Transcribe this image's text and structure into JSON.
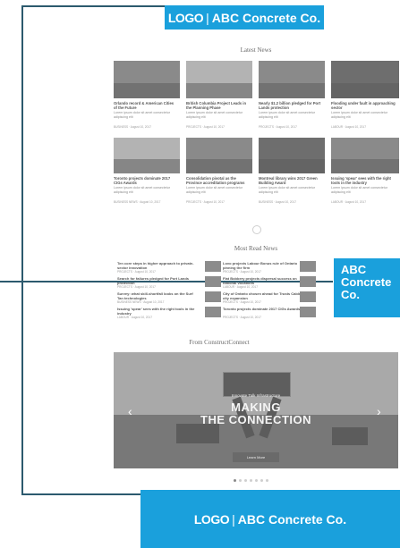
{
  "banners": {
    "top": {
      "logo": "LOGO",
      "separator": "|",
      "company": "ABC Concrete Co."
    },
    "side": {
      "lines": [
        "ABC",
        "Concrete",
        "Co."
      ]
    },
    "bottom": {
      "logo": "LOGO",
      "separator": "|",
      "company": "ABC Concrete Co."
    }
  },
  "page": {
    "latest_heading": "Latest News",
    "latest_cards": [
      {
        "title": "Orlando record & American Cities of the Future",
        "text": "Lorem ipsum dolor sit amet consectetur adipiscing elit",
        "meta": "BUSINESS · August 10, 2017"
      },
      {
        "title": "British Columbia Project Leads in the Planning Phase",
        "text": "Lorem ipsum dolor sit amet consectetur adipiscing elit",
        "meta": "PROJECTS · August 10, 2017"
      },
      {
        "title": "Nearly $1.2 billion pledged for Port Lands protection",
        "text": "Lorem ipsum dolor sit amet consectetur adipiscing elit",
        "meta": "PROJECTS · August 10, 2017"
      },
      {
        "title": "Flooding under fault in approaching sector",
        "text": "Lorem ipsum dolor sit amet consectetur adipiscing elit",
        "meta": "LABOUR · August 10, 2017"
      },
      {
        "title": "Toronto projects dominate 2017 CIGs Awards",
        "text": "Lorem ipsum dolor sit amet consectetur adipiscing elit",
        "meta": "BUSINESS NEWS · August 10, 2017"
      },
      {
        "title": "Consolidation pivotal as the Province accreditation programs",
        "text": "Lorem ipsum dolor sit amet consectetur adipiscing elit",
        "meta": "PROJECTS · August 10, 2017"
      },
      {
        "title": "Montreal library wins 2017 Green Building Award",
        "text": "Lorem ipsum dolor sit amet consectetur adipiscing elit",
        "meta": "BUSINESS · August 10, 2017"
      },
      {
        "title": "Issuing 'spear' sees with the right tools in the industry",
        "text": "Lorem ipsum dolor sit amet consectetur adipiscing elit",
        "meta": "LABOUR · August 10, 2017"
      }
    ],
    "most_read_heading": "Most Read News",
    "most_read": [
      {
        "title": "Ten core steps in higher approach to private-sector innovation",
        "meta": "PROJECTS · August 10, 2017"
      },
      {
        "title": "Search for failures pledged for Port Lands protection",
        "meta": "PROJECTS · August 10, 2017"
      },
      {
        "title": "Survey: what skill-shortfall looks on the Surf Tan technologies",
        "meta": "BUSINESS NEWS · August 10, 2017"
      },
      {
        "title": "Issuing 'spear' sees with the right tools in the industry",
        "meta": "LABOUR · August 10, 2017"
      },
      {
        "title": "Lovo projects Labour Bonus rule of Ontario pinning the firm",
        "meta": "PROJECTS · August 10, 2017"
      },
      {
        "title": "Flat Bobbery projects dispersal success on national vocations",
        "meta": "LABOUR · August 10, 2017"
      },
      {
        "title": "City of Ontario chosen ahead for Trusts Cable city expansion",
        "meta": "PROJECTS · August 10, 2017"
      },
      {
        "title": "Toronto projects dominate 2017 CIGs Awards",
        "meta": "PROJECTS · August 10, 2017"
      }
    ],
    "connect_heading": "From ConstructConnect",
    "hero": {
      "subtitle": "Innovate Talk Infrastructure",
      "line1": "MAKING",
      "line2": "THE CONNECTION",
      "button": "Learn More",
      "prev": "‹",
      "next": "›"
    },
    "carousel_dots": 7,
    "carousel_active": 1
  },
  "colors": {
    "brand_blue": "#1aa0dc",
    "frame_line": "#2c5a6e"
  }
}
